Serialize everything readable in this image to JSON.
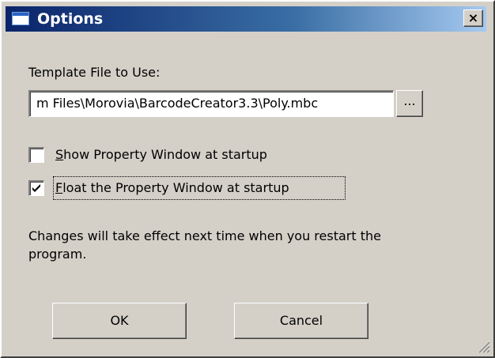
{
  "window": {
    "title": "Options",
    "close_label": "×"
  },
  "template": {
    "label": "Template File to Use:",
    "path_value": "m Files\\Morovia\\BarcodeCreator3.3\\Poly.mbc",
    "browse_label": "..."
  },
  "options": [
    {
      "mnemonic": "S",
      "label_rest": "how Property Window at startup",
      "checked": false
    },
    {
      "mnemonic": "F",
      "label_rest": "loat the Property Window at startup",
      "checked": true
    }
  ],
  "notice": {
    "line1": "Changes will take effect next time when you restart the",
    "line2": "program."
  },
  "buttons": {
    "ok_label": "OK",
    "cancel_label": "Cancel"
  },
  "colors": {
    "title_gradient_start": "#0a246a",
    "title_gradient_end": "#a6caf0",
    "face": "#d4d0c8"
  },
  "icons": {
    "title": "window-icon",
    "close": "close-icon",
    "check": "checkmark-icon",
    "grip": "resize-grip-icon"
  }
}
